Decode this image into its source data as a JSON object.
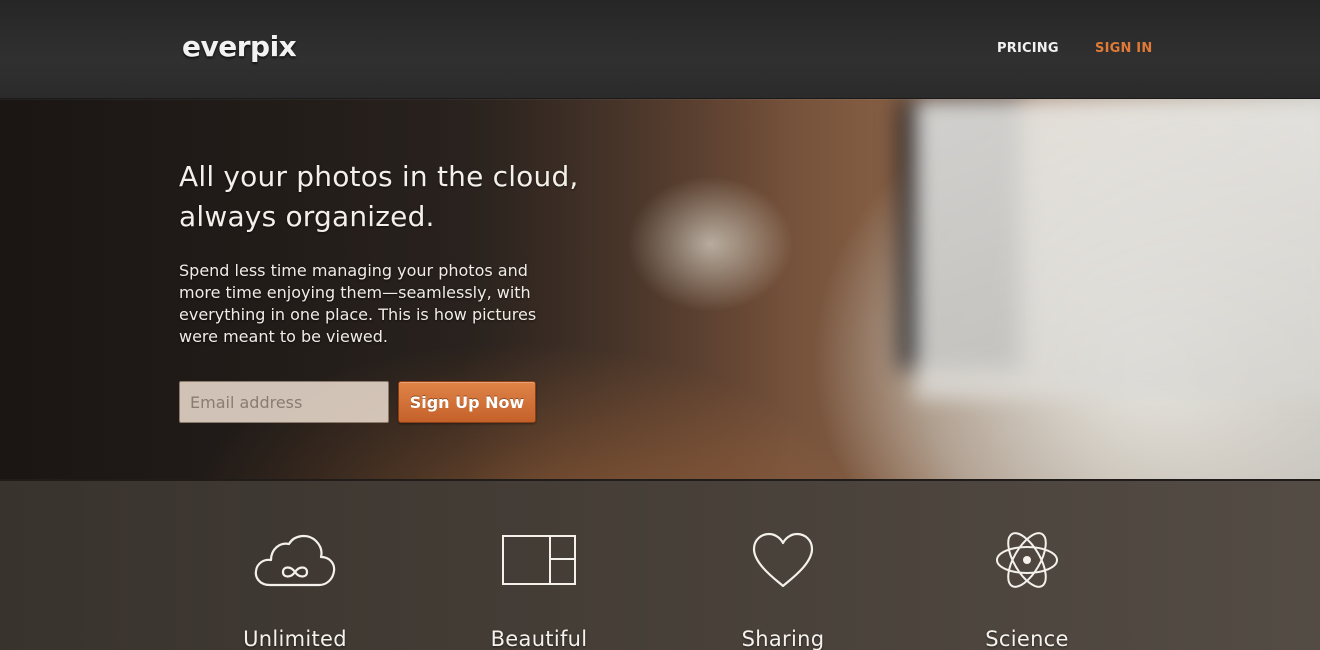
{
  "header": {
    "logo": "everpix",
    "nav": {
      "pricing": "PRICING",
      "sign_in": "SIGN IN"
    }
  },
  "hero": {
    "headline": "All your photos in the cloud, always organized.",
    "tagline": "Spend less time managing your photos and more time enjoying them—seamlessly, with everything in one place. This is how pictures were meant to be viewed.",
    "email_placeholder": "Email address",
    "signup_label": "Sign Up Now"
  },
  "features": [
    {
      "icon": "cloud-infinity-icon",
      "label": "Unlimited"
    },
    {
      "icon": "layout-grid-icon",
      "label": "Beautiful"
    },
    {
      "icon": "heart-icon",
      "label": "Sharing"
    },
    {
      "icon": "atom-icon",
      "label": "Science"
    }
  ],
  "colors": {
    "accent": "#e07a36",
    "header_bg": "#2b2b2b",
    "button_top": "#e08448",
    "button_bottom": "#c4612a"
  }
}
